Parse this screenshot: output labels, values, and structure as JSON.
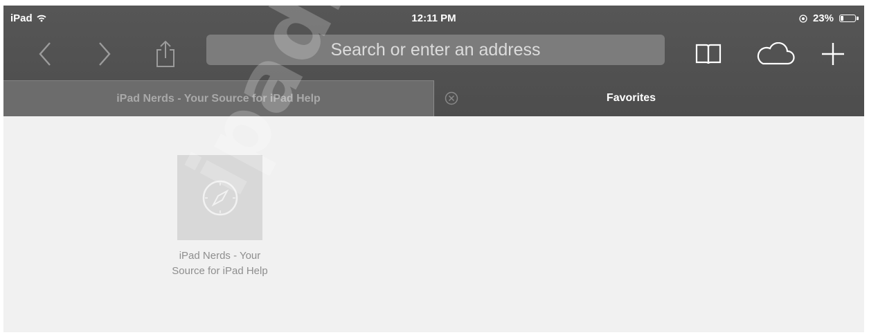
{
  "status_bar": {
    "carrier": "iPad",
    "time": "12:11 PM",
    "battery_percent": "23%",
    "battery_level": 0.23
  },
  "toolbar": {
    "address_placeholder": "Search or enter an address",
    "buttons": [
      "back-icon",
      "forward-icon",
      "share-icon",
      "bookmarks-icon",
      "icloud-tabs-icon",
      "new-tab-icon"
    ]
  },
  "tabs": [
    {
      "label": "iPad Nerds - Your Source for iPad Help",
      "active": false
    },
    {
      "label": "Favorites",
      "active": true
    }
  ],
  "favorites": [
    {
      "title_line1": "iPad Nerds - Your",
      "title_line2": "Source for iPad Help",
      "icon": "compass-icon"
    }
  ],
  "watermark": "ipadnerds.com",
  "colors": {
    "chrome": "#565656",
    "content_bg": "#f1f1f1",
    "address_bg": "#7c7c7c"
  }
}
